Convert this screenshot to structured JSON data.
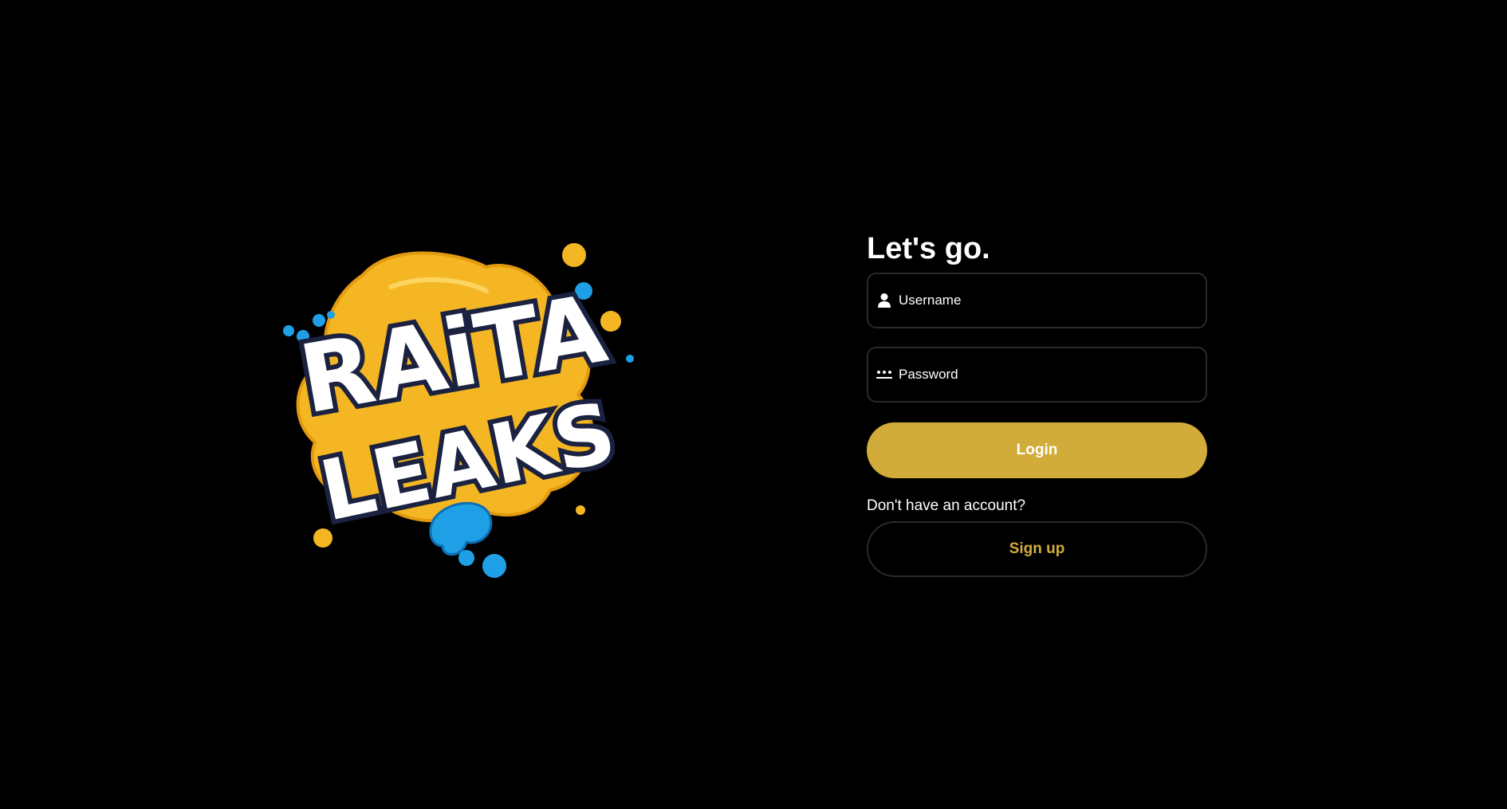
{
  "logo": {
    "line1": "RAiTA",
    "line2": "LEAKS"
  },
  "login": {
    "title": "Let's go.",
    "username": {
      "placeholder": "Username",
      "icon": "user-icon"
    },
    "password": {
      "placeholder": "Password",
      "icon": "password-dots-icon"
    },
    "login_label": "Login",
    "signup_prompt": "Don't have an account?",
    "signup_label": "Sign up"
  },
  "colors": {
    "background": "#000000",
    "accent": "#d2ac3a",
    "border": "#2a2a2a",
    "text": "#ffffff",
    "logo_yellow": "#f5b623",
    "logo_blue": "#1fa0e6"
  }
}
